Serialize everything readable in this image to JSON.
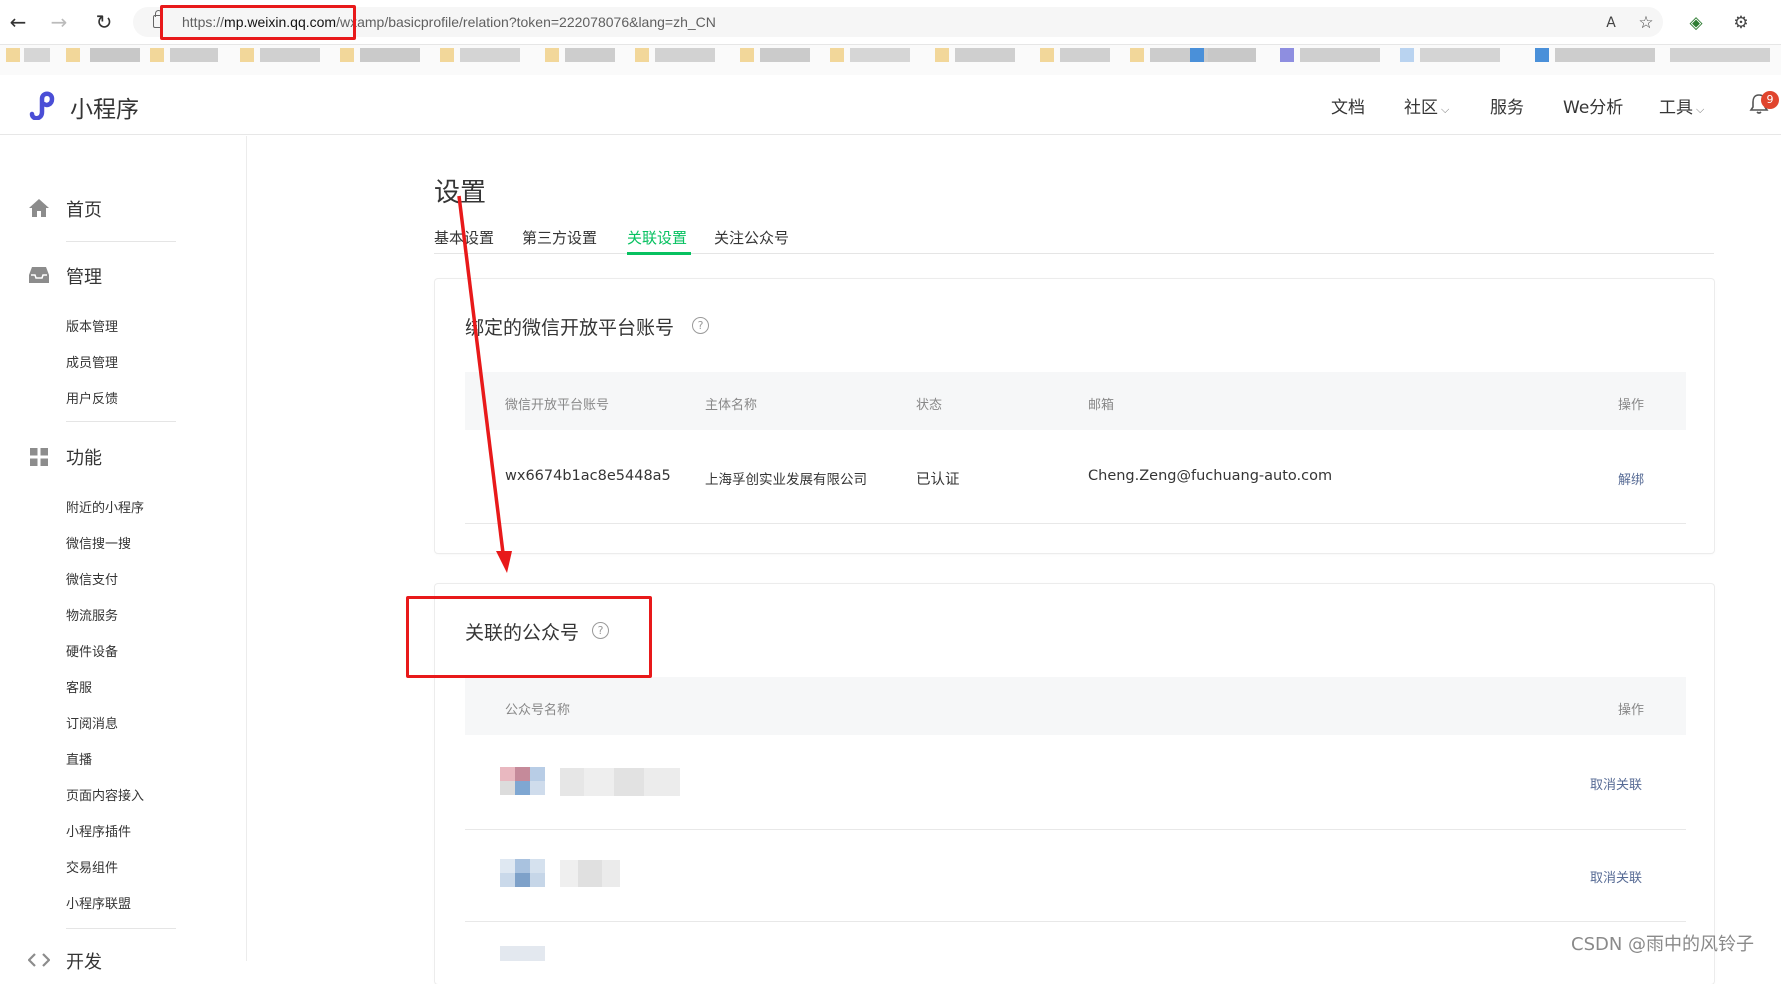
{
  "browser": {
    "url_scheme": "https://",
    "url_host": "mp.weixin.qq.com",
    "url_path": "/wxamp/basicprofile/relation?token=222078076&lang=zh_CN",
    "back_icon": "←",
    "forward_icon": "→",
    "reload_icon": "↻",
    "read_aloud_icon": "A",
    "favorite_icon": "☆",
    "extension_icon": "⚙"
  },
  "header": {
    "brand": "小程序",
    "nav": [
      "文档",
      "社区",
      "服务",
      "We分析",
      "工具"
    ],
    "notification_count": "9"
  },
  "sidebar": {
    "home": "首页",
    "manage": {
      "title": "管理",
      "items": [
        "版本管理",
        "成员管理",
        "用户反馈"
      ]
    },
    "features": {
      "title": "功能",
      "items": [
        "附近的小程序",
        "微信搜一搜",
        "微信支付",
        "物流服务",
        "硬件设备",
        "客服",
        "订阅消息",
        "直播",
        "页面内容接入",
        "小程序插件",
        "交易组件",
        "小程序联盟"
      ]
    },
    "dev": "开发"
  },
  "main": {
    "title": "设置",
    "tabs": [
      "基本设置",
      "第三方设置",
      "关联设置",
      "关注公众号"
    ],
    "active_tab": "关联设置",
    "open_platform": {
      "title": "绑定的微信开放平台账号",
      "help": "?",
      "columns": [
        "微信开放平台账号",
        "主体名称",
        "状态",
        "邮箱",
        "操作"
      ],
      "rows": [
        {
          "account": "wx6674b1ac8e5448a5",
          "entity": "上海孚创实业发展有限公司",
          "status": "已认证",
          "email": "Cheng.Zeng@fuchuang-auto.com",
          "action": "解绑"
        }
      ]
    },
    "official_accounts": {
      "title": "关联的公众号",
      "help": "?",
      "columns": [
        "公众号名称",
        "操作"
      ],
      "rows": [
        {
          "action": "取消关联"
        },
        {
          "action": "取消关联"
        }
      ]
    }
  },
  "watermark": "CSDN @雨中的风铃子",
  "colors": {
    "accent": "#07c160",
    "link": "#576b95",
    "annotation_red": "#e8191a",
    "brand_blue": "#4a4ed6"
  }
}
